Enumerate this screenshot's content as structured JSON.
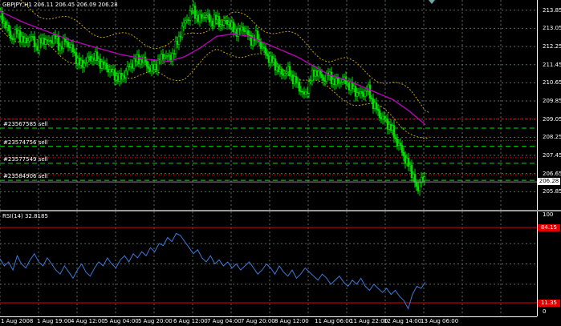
{
  "header": {
    "symbol": "GBPJPY,H1",
    "ohlc": "206.11 206.45 206.09 206.28"
  },
  "rsi_header": "RSI(14) 32.8185",
  "price_axis": [
    "213.85",
    "213.05",
    "212.25",
    "211.45",
    "210.65",
    "209.85",
    "209.05",
    "208.25",
    "207.45",
    "206.65",
    "205.85"
  ],
  "rsi_axis": [
    "100",
    "0"
  ],
  "current_price": "206.28",
  "rsi_levels": {
    "upper": "84.15",
    "lower": "11.35"
  },
  "time_axis": [
    "1 Aug 2008",
    "1 Aug 19:00",
    "4 Aug 12:00",
    "5 Aug 04:00",
    "5 Aug 20:00",
    "6 Aug 12:00",
    "7 Aug 04:00",
    "7 Aug 20:00",
    "8 Aug 12:00",
    "11 Aug 06:00",
    "11 Aug 22:00",
    "12 Aug 14:00",
    "13 Aug 06:00"
  ],
  "orders": [
    {
      "label": "#23567585 sell",
      "price": 208.65
    },
    {
      "label": "#23574756 sell",
      "price": 207.85
    },
    {
      "label": "#23577549 sell",
      "price": 207.1
    },
    {
      "label": "#23584906 sell",
      "price": 206.35
    }
  ],
  "colors": {
    "bull": "#00e000",
    "ma": "#c000c0",
    "bands": "#c8a000",
    "grid": "#5a6e5a",
    "rsi": "#3c78d8",
    "level": "#e00000"
  },
  "chart_data": {
    "type": "candlestick+line",
    "symbol": "GBPJPY",
    "timeframe": "H1",
    "ylim": [
      205.05,
      214.3
    ],
    "close_path": [
      [
        0,
        213.6
      ],
      [
        6,
        213.3
      ],
      [
        14,
        212.6
      ],
      [
        22,
        212.9
      ],
      [
        30,
        212.4
      ],
      [
        38,
        212.7
      ],
      [
        46,
        212.2
      ],
      [
        54,
        212.6
      ],
      [
        60,
        212.4
      ],
      [
        68,
        212.7
      ],
      [
        74,
        212.2
      ],
      [
        82,
        212.5
      ],
      [
        90,
        212.1
      ],
      [
        100,
        211.4
      ],
      [
        110,
        211.7
      ],
      [
        118,
        211.8
      ],
      [
        126,
        211.5
      ],
      [
        134,
        211.3
      ],
      [
        142,
        211.0
      ],
      [
        150,
        210.8
      ],
      [
        156,
        211.1
      ],
      [
        164,
        211.5
      ],
      [
        172,
        211.7
      ],
      [
        180,
        211.6
      ],
      [
        188,
        211.2
      ],
      [
        196,
        211.5
      ],
      [
        204,
        211.9
      ],
      [
        212,
        211.7
      ],
      [
        220,
        212.3
      ],
      [
        226,
        213.0
      ],
      [
        232,
        213.4
      ],
      [
        240,
        213.9
      ],
      [
        248,
        213.4
      ],
      [
        256,
        213.7
      ],
      [
        262,
        213.3
      ],
      [
        268,
        213.5
      ],
      [
        276,
        213.2
      ],
      [
        284,
        213.4
      ],
      [
        290,
        213.0
      ],
      [
        298,
        212.9
      ],
      [
        304,
        213.1
      ],
      [
        312,
        212.5
      ],
      [
        320,
        212.7
      ],
      [
        328,
        212.1
      ],
      [
        336,
        211.7
      ],
      [
        344,
        211.4
      ],
      [
        350,
        211.0
      ],
      [
        358,
        211.2
      ],
      [
        366,
        210.8
      ],
      [
        374,
        210.4
      ],
      [
        380,
        210.0
      ],
      [
        386,
        210.8
      ],
      [
        394,
        211.2
      ],
      [
        402,
        210.8
      ],
      [
        410,
        211.0
      ],
      [
        418,
        210.6
      ],
      [
        426,
        210.8
      ],
      [
        434,
        210.6
      ],
      [
        442,
        210.3
      ],
      [
        450,
        210.1
      ],
      [
        458,
        210.4
      ],
      [
        464,
        209.8
      ],
      [
        470,
        209.4
      ],
      [
        476,
        209.1
      ],
      [
        482,
        208.9
      ],
      [
        488,
        208.6
      ],
      [
        494,
        208.1
      ],
      [
        500,
        207.7
      ],
      [
        506,
        207.2
      ],
      [
        512,
        206.8
      ],
      [
        516,
        206.5
      ],
      [
        520,
        205.7
      ],
      [
        524,
        206.6
      ],
      [
        528,
        206.28
      ]
    ],
    "ma_path": [
      [
        0,
        213.8
      ],
      [
        30,
        213.3
      ],
      [
        60,
        212.9
      ],
      [
        90,
        212.5
      ],
      [
        120,
        212.2
      ],
      [
        150,
        211.9
      ],
      [
        180,
        211.7
      ],
      [
        210,
        211.6
      ],
      [
        230,
        211.8
      ],
      [
        250,
        212.2
      ],
      [
        270,
        212.7
      ],
      [
        290,
        212.8
      ],
      [
        310,
        212.7
      ],
      [
        330,
        212.4
      ],
      [
        350,
        212.1
      ],
      [
        370,
        211.8
      ],
      [
        390,
        211.4
      ],
      [
        410,
        211.0
      ],
      [
        430,
        210.8
      ],
      [
        450,
        210.5
      ],
      [
        470,
        210.2
      ],
      [
        490,
        209.9
      ],
      [
        510,
        209.4
      ],
      [
        530,
        208.8
      ]
    ],
    "band_offset": 0.75,
    "rsi": {
      "ylim": [
        0,
        100
      ],
      "values": [
        55,
        48,
        52,
        44,
        58,
        50,
        46,
        54,
        60,
        52,
        48,
        56,
        50,
        44,
        40,
        48,
        42,
        36,
        44,
        50,
        42,
        38,
        46,
        52,
        48,
        56,
        50,
        46,
        54,
        58,
        52,
        60,
        56,
        62,
        58,
        66,
        62,
        70,
        68,
        76,
        72,
        80,
        78,
        72,
        66,
        60,
        64,
        56,
        52,
        58,
        50,
        54,
        48,
        52,
        46,
        50,
        44,
        48,
        52,
        46,
        40,
        44,
        50,
        46,
        40,
        48,
        42,
        38,
        44,
        36,
        40,
        46,
        42,
        38,
        34,
        40,
        36,
        30,
        34,
        38,
        32,
        28,
        34,
        30,
        36,
        28,
        24,
        30,
        26,
        22,
        26,
        20,
        24,
        18,
        14,
        6,
        20,
        28,
        26,
        32
      ]
    }
  }
}
